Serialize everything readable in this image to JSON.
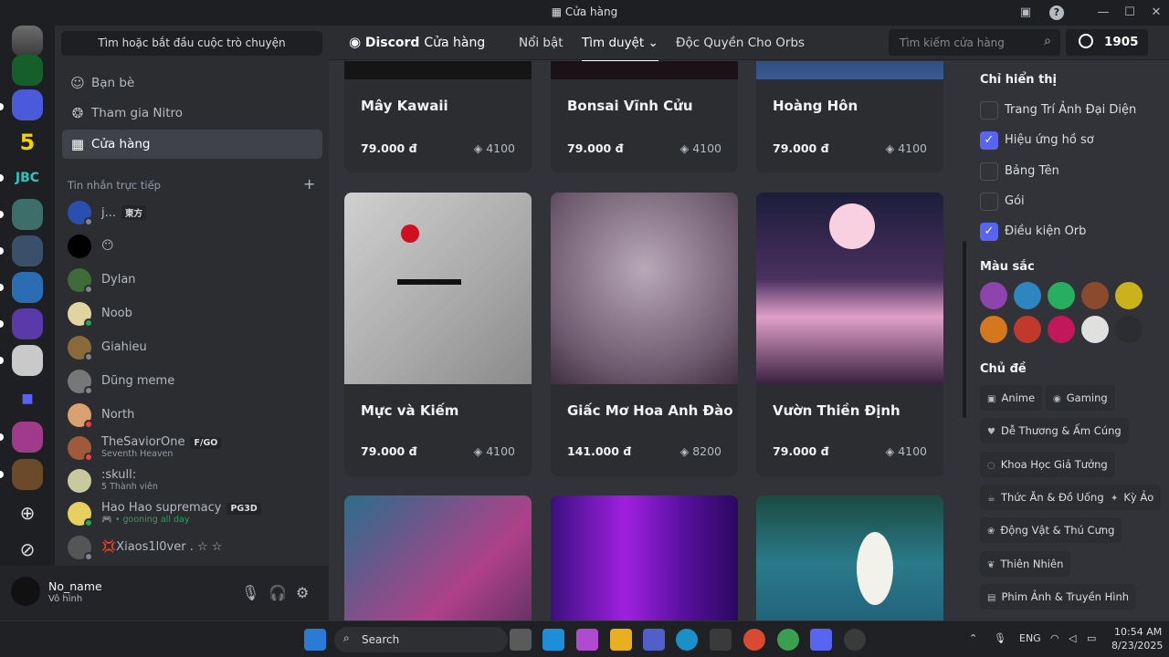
{
  "window": {
    "title": "Cửa hàng"
  },
  "sidebar": {
    "search_label": "Tìm hoặc bắt đầu cuộc trò chuyện",
    "nav": [
      {
        "label": "Bạn bè",
        "icon": "friends-icon"
      },
      {
        "label": "Tham gia Nitro",
        "icon": "nitro-icon"
      },
      {
        "label": "Cửa hàng",
        "icon": "shop-icon"
      }
    ],
    "dm_header": "Tin nhắn trực tiếp",
    "dms": [
      {
        "name": "j...",
        "tag": "東方",
        "sub": ""
      },
      {
        "name": "😶",
        "tag": "",
        "sub": ""
      },
      {
        "name": "Dylan",
        "tag": "",
        "sub": ""
      },
      {
        "name": "Noob",
        "tag": "",
        "sub": ""
      },
      {
        "name": "Giahieu",
        "tag": "",
        "sub": ""
      },
      {
        "name": "Dũng meme",
        "tag": "",
        "sub": ""
      },
      {
        "name": "North",
        "tag": "",
        "sub": ""
      },
      {
        "name": "TheSaviorOne",
        "tag": "F/GO",
        "sub": "Seventh Heaven"
      },
      {
        "name": ":skull:",
        "tag": "",
        "sub": "5 Thành viên"
      },
      {
        "name": "Hao Hao supremacy",
        "tag": "PG3D",
        "sub": "🎮 • gooning all day"
      },
      {
        "name": "💢Xiaos1l0ver . ☆ ☆",
        "tag": "",
        "sub": ""
      }
    ],
    "user": {
      "name": "No_name",
      "status": "Vô hình"
    }
  },
  "shop": {
    "logo": "Discord",
    "logo_suffix": "Cửa hàng",
    "nav": [
      "Nổi bật",
      "Tìm duyệt",
      "Độc Quyền Cho Orbs"
    ],
    "search_placeholder": "Tìm kiếm cửa hàng",
    "orbs_balance": "1905",
    "cards": [
      {
        "name": "Mây Kawaii",
        "price": "79.000 đ",
        "orbs": "4100"
      },
      {
        "name": "Bonsai Vĩnh Cửu",
        "price": "79.000 đ",
        "orbs": "4100"
      },
      {
        "name": "Hoàng Hôn",
        "price": "79.000 đ",
        "orbs": "4100"
      },
      {
        "name": "Mực và Kiếm",
        "price": "79.000 đ",
        "orbs": "4100"
      },
      {
        "name": "Giấc Mơ Hoa Anh Đào",
        "price": "141.000 đ",
        "orbs": "8200"
      },
      {
        "name": "Vườn Thiền Định",
        "price": "79.000 đ",
        "orbs": "4100"
      },
      {
        "name": "",
        "price": "",
        "orbs": ""
      },
      {
        "name": "",
        "price": "",
        "orbs": ""
      },
      {
        "name": "",
        "price": "",
        "orbs": ""
      }
    ],
    "filters": {
      "show_only": "Chỉ hiển thị",
      "options": [
        {
          "label": "Trang Trí Ảnh Đại Diện",
          "checked": false
        },
        {
          "label": "Hiệu ứng hồ sơ",
          "checked": true
        },
        {
          "label": "Bảng Tên",
          "checked": false
        },
        {
          "label": "Gói",
          "checked": false
        },
        {
          "label": "Điều kiện Orb",
          "checked": true
        }
      ],
      "colors_title": "Màu sắc",
      "colors": [
        "#8e44ad",
        "#2e86c1",
        "#27ae60",
        "#8b4a2b",
        "#c9b21a",
        "#d4771d",
        "#c0392b",
        "#c2185b",
        "#e0e0e0",
        "#2b2d31"
      ],
      "themes_title": "Chủ đề",
      "themes": [
        "Anime",
        "Gaming",
        "Dễ Thương & Ấm Cúng",
        "Khoa Học Giả Tưởng",
        "Thức Ăn & Đồ Uống",
        "Kỳ Ảo",
        "Động Vật & Thú Cưng",
        "Thiên Nhiên",
        "Phim Ảnh & Truyền Hình"
      ]
    }
  },
  "taskbar": {
    "search": "Search",
    "lang": "ENG",
    "time": "10:54 AM",
    "date": "8/23/2025"
  }
}
